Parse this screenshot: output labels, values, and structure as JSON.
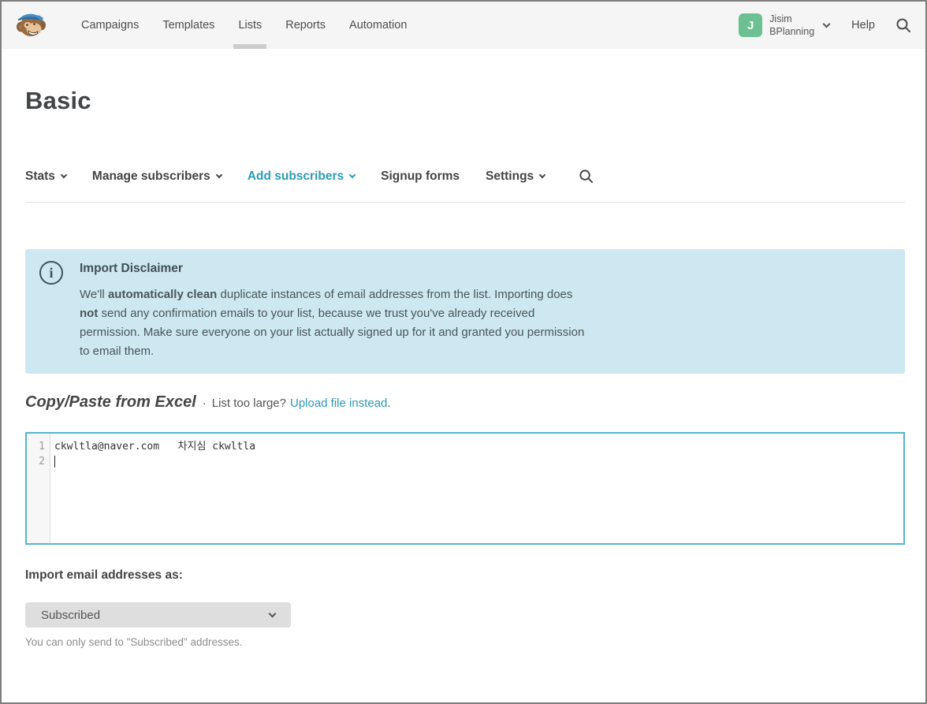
{
  "topnav": {
    "items": [
      {
        "label": "Campaigns"
      },
      {
        "label": "Templates"
      },
      {
        "label": "Lists"
      },
      {
        "label": "Reports"
      },
      {
        "label": "Automation"
      }
    ],
    "active_item": "Lists",
    "user": {
      "initial": "J",
      "name": "Jisim",
      "org": "BPlanning"
    },
    "help_label": "Help"
  },
  "page": {
    "title": "Basic"
  },
  "subnav": {
    "items": [
      {
        "label": "Stats"
      },
      {
        "label": "Manage subscribers"
      },
      {
        "label": "Add subscribers"
      },
      {
        "label": "Signup forms"
      },
      {
        "label": "Settings"
      }
    ],
    "active_item": "Add subscribers"
  },
  "disclaimer": {
    "title": "Import Disclaimer",
    "body": {
      "s1": "We'll ",
      "s2": "automatically clean",
      "s3": " duplicate instances of email addresses from the list. Importing does ",
      "s4": "not",
      "s5": " send any confirmation emails to your list, because we trust you've already received permission. Make sure everyone on your list actually signed up for it and granted you permission to email them."
    }
  },
  "paste_section": {
    "heading": "Copy/Paste from Excel",
    "separator": "·",
    "prompt": "List too large?",
    "link_label": "Upload file instead",
    "period": ".",
    "editor": {
      "lines": [
        {
          "number": "1",
          "text": "ckwltla@naver.com   차지심 ckwltla"
        },
        {
          "number": "2",
          "text": ""
        }
      ]
    }
  },
  "import_as": {
    "label": "Import email addresses as:",
    "selected_option": "Subscribed",
    "note": "You can only send to \"Subscribed\" addresses."
  },
  "icons": {
    "logo": "freddie-monkey-logo",
    "chevron": "chevron-down",
    "search": "magnifier",
    "info": "i"
  },
  "colors": {
    "accent_teal": "#2c9ab7",
    "avatar_green": "#6cc091",
    "info_box_bg": "#cde8f0",
    "editor_border": "#54b7cf",
    "topnav_bg": "#f5f5f5"
  }
}
